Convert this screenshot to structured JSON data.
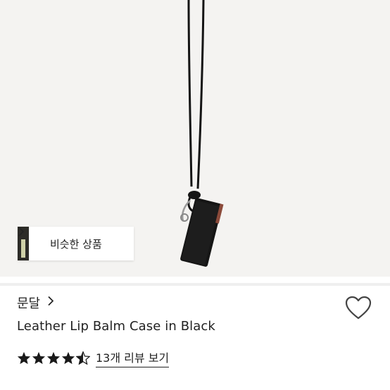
{
  "hero": {
    "image_subject": "black leather lip balm case on long black cord"
  },
  "similar_products": {
    "label": "비슷한 상품",
    "chevron_icon": "chevron-right-icon"
  },
  "product": {
    "brand": "문달",
    "brand_chevron": ">",
    "title": "Leather Lip Balm Case in Black",
    "rating": 4.5,
    "rating_max": 5,
    "review_link": "13개 리뷰 보기",
    "wishlist_icon": "heart-outline-icon"
  },
  "colors": {
    "hero_bg": "#f4f3f1",
    "star": "#1a1a1a"
  }
}
